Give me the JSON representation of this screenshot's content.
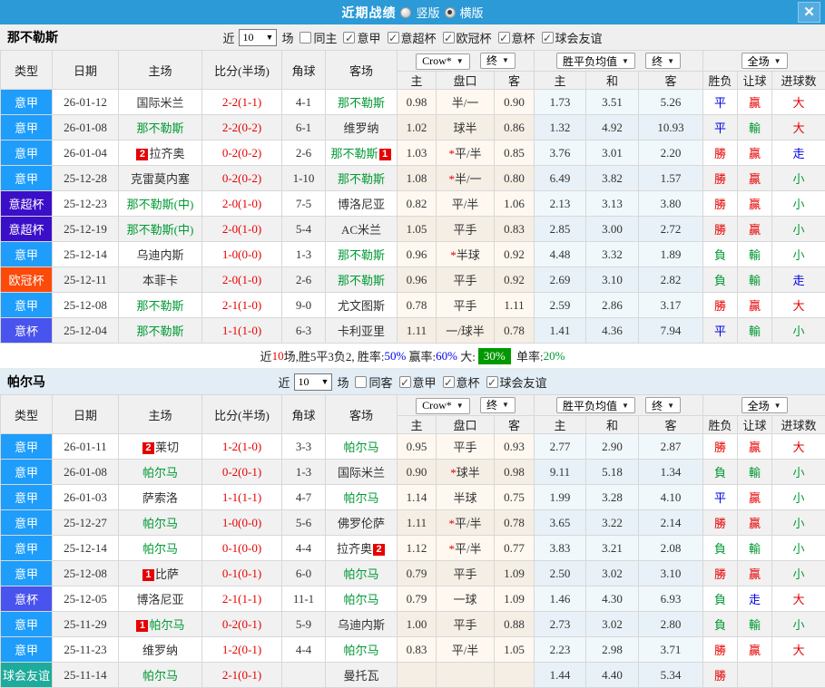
{
  "titlebar": {
    "title": "近期战绩",
    "options": [
      {
        "label": "竖版",
        "selected": false
      },
      {
        "label": "横版",
        "selected": true
      }
    ],
    "close": "✕"
  },
  "ui": {
    "caret": "▼",
    "check": "✓"
  },
  "columns": {
    "type": "类型",
    "date": "日期",
    "home": "主场",
    "score": "比分(半场)",
    "corner": "角球",
    "away": "客场",
    "h": "主",
    "handicap": "盘口",
    "a": "客",
    "avg_h": "主",
    "avg_d": "和",
    "avg_a": "客",
    "wdl": "胜负",
    "let_goal": "让球",
    "goals": "进球数"
  },
  "dropdowns": {
    "odds": "Crow*",
    "final": "终",
    "avg": "胜平负均值",
    "fulltime": "全场"
  },
  "colors": {
    "league": {
      "意甲": "#1E9DFB",
      "意超杯": "#3B0FC8",
      "欧冠杯": "#FC4A0A",
      "意杯": "#4953EE",
      "球会友谊": "#1EAB9B"
    },
    "accent_red": "#E60000",
    "accent_green": "#009933",
    "accent_blue": "#0000E6",
    "topbar": "#2B9AD6"
  },
  "sections": [
    {
      "team": "那不勒斯",
      "filter": {
        "near": "近",
        "count": "10",
        "games": "场",
        "same": {
          "label": "同主",
          "checked": false
        },
        "leagues": [
          {
            "label": "意甲",
            "checked": true
          },
          {
            "label": "意超杯",
            "checked": true
          },
          {
            "label": "欧冠杯",
            "checked": true
          },
          {
            "label": "意杯",
            "checked": true
          },
          {
            "label": "球会友谊",
            "checked": true
          }
        ]
      },
      "rows": [
        {
          "type": "意甲",
          "date": "26-01-12",
          "home": {
            "text": "国际米兰"
          },
          "score": "2-2(1-1)",
          "corner": "4-1",
          "away": {
            "text": "那不勒斯",
            "green": true
          },
          "odds": [
            "0.98",
            "半/一",
            "0.90"
          ],
          "avg": [
            "1.73",
            "3.51",
            "5.26"
          ],
          "res": [
            "平",
            "贏",
            "大"
          ]
        },
        {
          "type": "意甲",
          "date": "26-01-08",
          "home": {
            "text": "那不勒斯",
            "green": true
          },
          "score": "2-2(0-2)",
          "corner": "6-1",
          "away": {
            "text": "维罗纳"
          },
          "odds": [
            "1.02",
            "球半",
            "0.86"
          ],
          "avg": [
            "1.32",
            "4.92",
            "10.93"
          ],
          "res": [
            "平",
            "輸",
            "大"
          ]
        },
        {
          "type": "意甲",
          "date": "26-01-04",
          "home": {
            "text": "拉齐奥",
            "badge": "2",
            "badgePos": "before"
          },
          "score": "0-2(0-2)",
          "corner": "2-6",
          "away": {
            "text": "那不勒斯",
            "green": true,
            "badge": "1",
            "badgePos": "after"
          },
          "odds": [
            "1.03",
            "*平/半",
            "0.85"
          ],
          "avg": [
            "3.76",
            "3.01",
            "2.20"
          ],
          "res": [
            "勝",
            "贏",
            "走"
          ]
        },
        {
          "type": "意甲",
          "date": "25-12-28",
          "home": {
            "text": "克雷莫内塞"
          },
          "score": "0-2(0-2)",
          "corner": "1-10",
          "away": {
            "text": "那不勒斯",
            "green": true
          },
          "odds": [
            "1.08",
            "*半/一",
            "0.80"
          ],
          "avg": [
            "6.49",
            "3.82",
            "1.57"
          ],
          "res": [
            "勝",
            "贏",
            "小"
          ]
        },
        {
          "type": "意超杯",
          "date": "25-12-23",
          "home": {
            "text": "那不勒斯(中)",
            "green": true
          },
          "score": "2-0(1-0)",
          "corner": "7-5",
          "away": {
            "text": "博洛尼亚"
          },
          "odds": [
            "0.82",
            "平/半",
            "1.06"
          ],
          "avg": [
            "2.13",
            "3.13",
            "3.80"
          ],
          "res": [
            "勝",
            "贏",
            "小"
          ]
        },
        {
          "type": "意超杯",
          "date": "25-12-19",
          "home": {
            "text": "那不勒斯(中)",
            "green": true
          },
          "score": "2-0(1-0)",
          "corner": "5-4",
          "away": {
            "text": "AC米兰"
          },
          "odds": [
            "1.05",
            "平手",
            "0.83"
          ],
          "avg": [
            "2.85",
            "3.00",
            "2.72"
          ],
          "res": [
            "勝",
            "贏",
            "小"
          ]
        },
        {
          "type": "意甲",
          "date": "25-12-14",
          "home": {
            "text": "乌迪内斯"
          },
          "score": "1-0(0-0)",
          "corner": "1-3",
          "away": {
            "text": "那不勒斯",
            "green": true
          },
          "odds": [
            "0.96",
            "*半球",
            "0.92"
          ],
          "avg": [
            "4.48",
            "3.32",
            "1.89"
          ],
          "res": [
            "負",
            "輸",
            "小"
          ]
        },
        {
          "type": "欧冠杯",
          "date": "25-12-11",
          "home": {
            "text": "本菲卡"
          },
          "score": "2-0(1-0)",
          "corner": "2-6",
          "away": {
            "text": "那不勒斯",
            "green": true
          },
          "odds": [
            "0.96",
            "平手",
            "0.92"
          ],
          "avg": [
            "2.69",
            "3.10",
            "2.82"
          ],
          "res": [
            "負",
            "輸",
            "走"
          ]
        },
        {
          "type": "意甲",
          "date": "25-12-08",
          "home": {
            "text": "那不勒斯",
            "green": true
          },
          "score": "2-1(1-0)",
          "corner": "9-0",
          "away": {
            "text": "尤文图斯"
          },
          "odds": [
            "0.78",
            "平手",
            "1.11"
          ],
          "avg": [
            "2.59",
            "2.86",
            "3.17"
          ],
          "res": [
            "勝",
            "贏",
            "大"
          ]
        },
        {
          "type": "意杯",
          "date": "25-12-04",
          "home": {
            "text": "那不勒斯",
            "green": true
          },
          "score": "1-1(1-0)",
          "corner": "6-3",
          "away": {
            "text": "卡利亚里"
          },
          "odds": [
            "1.11",
            "一/球半",
            "0.78"
          ],
          "avg": [
            "1.41",
            "4.36",
            "7.94"
          ],
          "res": [
            "平",
            "輸",
            "小"
          ]
        }
      ],
      "summary": [
        {
          "t": "近",
          "c": "k"
        },
        {
          "t": "10",
          "c": "r"
        },
        {
          "t": "场,胜5平3负2, 胜率:",
          "c": "k"
        },
        {
          "t": "50%",
          "c": "b"
        },
        {
          "t": " 赢率:",
          "c": "k"
        },
        {
          "t": "60%",
          "c": "b"
        },
        {
          "t": " 大:",
          "c": "k"
        },
        {
          "t": "30%",
          "c": "gbox"
        },
        {
          "t": " 单率:",
          "c": "k"
        },
        {
          "t": "20%",
          "c": "g"
        }
      ]
    },
    {
      "team": "帕尔马",
      "filter": {
        "near": "近",
        "count": "10",
        "games": "场",
        "same": {
          "label": "同客",
          "checked": false
        },
        "leagues": [
          {
            "label": "意甲",
            "checked": true
          },
          {
            "label": "意杯",
            "checked": true
          },
          {
            "label": "球会友谊",
            "checked": true
          }
        ]
      },
      "rows": [
        {
          "type": "意甲",
          "date": "26-01-11",
          "home": {
            "text": "莱切",
            "badge": "2",
            "badgePos": "before"
          },
          "score": "1-2(1-0)",
          "corner": "3-3",
          "away": {
            "text": "帕尔马",
            "green": true
          },
          "odds": [
            "0.95",
            "平手",
            "0.93"
          ],
          "avg": [
            "2.77",
            "2.90",
            "2.87"
          ],
          "res": [
            "勝",
            "贏",
            "大"
          ]
        },
        {
          "type": "意甲",
          "date": "26-01-08",
          "home": {
            "text": "帕尔马",
            "green": true
          },
          "score": "0-2(0-1)",
          "corner": "1-3",
          "away": {
            "text": "国际米兰"
          },
          "odds": [
            "0.90",
            "*球半",
            "0.98"
          ],
          "avg": [
            "9.11",
            "5.18",
            "1.34"
          ],
          "res": [
            "負",
            "輸",
            "小"
          ]
        },
        {
          "type": "意甲",
          "date": "26-01-03",
          "home": {
            "text": "萨索洛"
          },
          "score": "1-1(1-1)",
          "corner": "4-7",
          "away": {
            "text": "帕尔马",
            "green": true
          },
          "odds": [
            "1.14",
            "半球",
            "0.75"
          ],
          "avg": [
            "1.99",
            "3.28",
            "4.10"
          ],
          "res": [
            "平",
            "贏",
            "小"
          ]
        },
        {
          "type": "意甲",
          "date": "25-12-27",
          "home": {
            "text": "帕尔马",
            "green": true
          },
          "score": "1-0(0-0)",
          "corner": "5-6",
          "away": {
            "text": "佛罗伦萨"
          },
          "odds": [
            "1.11",
            "*平/半",
            "0.78"
          ],
          "avg": [
            "3.65",
            "3.22",
            "2.14"
          ],
          "res": [
            "勝",
            "贏",
            "小"
          ]
        },
        {
          "type": "意甲",
          "date": "25-12-14",
          "home": {
            "text": "帕尔马",
            "green": true
          },
          "score": "0-1(0-0)",
          "corner": "4-4",
          "away": {
            "text": "拉齐奥",
            "badge": "2",
            "badgePos": "after"
          },
          "odds": [
            "1.12",
            "*平/半",
            "0.77"
          ],
          "avg": [
            "3.83",
            "3.21",
            "2.08"
          ],
          "res": [
            "負",
            "輸",
            "小"
          ]
        },
        {
          "type": "意甲",
          "date": "25-12-08",
          "home": {
            "text": "比萨",
            "badge": "1",
            "badgePos": "before"
          },
          "score": "0-1(0-1)",
          "corner": "6-0",
          "away": {
            "text": "帕尔马",
            "green": true
          },
          "odds": [
            "0.79",
            "平手",
            "1.09"
          ],
          "avg": [
            "2.50",
            "3.02",
            "3.10"
          ],
          "res": [
            "勝",
            "贏",
            "小"
          ]
        },
        {
          "type": "意杯",
          "date": "25-12-05",
          "home": {
            "text": "博洛尼亚"
          },
          "score": "2-1(1-1)",
          "corner": "11-1",
          "away": {
            "text": "帕尔马",
            "green": true
          },
          "odds": [
            "0.79",
            "一球",
            "1.09"
          ],
          "avg": [
            "1.46",
            "4.30",
            "6.93"
          ],
          "res": [
            "負",
            "走",
            "大"
          ]
        },
        {
          "type": "意甲",
          "date": "25-11-29",
          "home": {
            "text": "帕尔马",
            "green": true,
            "badge": "1",
            "badgePos": "before"
          },
          "score": "0-2(0-1)",
          "corner": "5-9",
          "away": {
            "text": "乌迪内斯"
          },
          "odds": [
            "1.00",
            "平手",
            "0.88"
          ],
          "avg": [
            "2.73",
            "3.02",
            "2.80"
          ],
          "res": [
            "負",
            "輸",
            "小"
          ]
        },
        {
          "type": "意甲",
          "date": "25-11-23",
          "home": {
            "text": "维罗纳"
          },
          "score": "1-2(0-1)",
          "corner": "4-4",
          "away": {
            "text": "帕尔马",
            "green": true
          },
          "odds": [
            "0.83",
            "平/半",
            "1.05"
          ],
          "avg": [
            "2.23",
            "2.98",
            "3.71"
          ],
          "res": [
            "勝",
            "贏",
            "大"
          ]
        },
        {
          "type": "球会友谊",
          "date": "25-11-14",
          "home": {
            "text": "帕尔马",
            "green": true
          },
          "score": "2-1(0-1)",
          "corner": "",
          "away": {
            "text": "曼托瓦"
          },
          "odds": [
            "",
            "",
            ""
          ],
          "avg": [
            "1.44",
            "4.40",
            "5.34"
          ],
          "res": [
            "勝",
            "",
            ""
          ]
        }
      ]
    }
  ]
}
